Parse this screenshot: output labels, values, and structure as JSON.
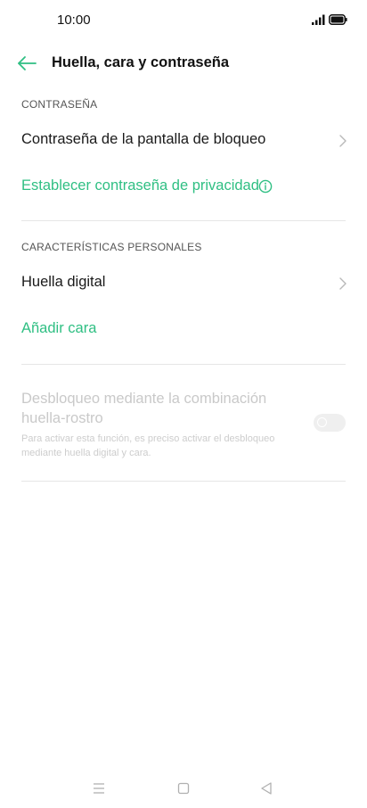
{
  "status_bar": {
    "time": "10:00"
  },
  "header": {
    "title": "Huella, cara y contraseña",
    "back_icon": "arrow-left-icon"
  },
  "colors": {
    "accent": "#2fbf83",
    "disabled_text": "#c9c9c9",
    "divider": "#e6e6e6"
  },
  "sections": {
    "password": {
      "header": "CONTRASEÑA",
      "lock_screen_password": "Contraseña de la pantalla de bloqueo",
      "privacy_password": "Establecer contraseña de privacidad"
    },
    "personal": {
      "header": "CARACTERÍSTICAS PERSONALES",
      "fingerprint": "Huella digital",
      "add_face": "Añadir cara"
    },
    "combo_unlock": {
      "title": "Desbloqueo mediante la combinación huella-rostro",
      "description": "Para activar esta función, es preciso activar el desbloqueo mediante huella digital y cara.",
      "toggle_state": "off",
      "enabled": false
    }
  },
  "nav_bar": {
    "icons": [
      "menu-icon",
      "home-icon",
      "back-triangle-icon"
    ]
  }
}
